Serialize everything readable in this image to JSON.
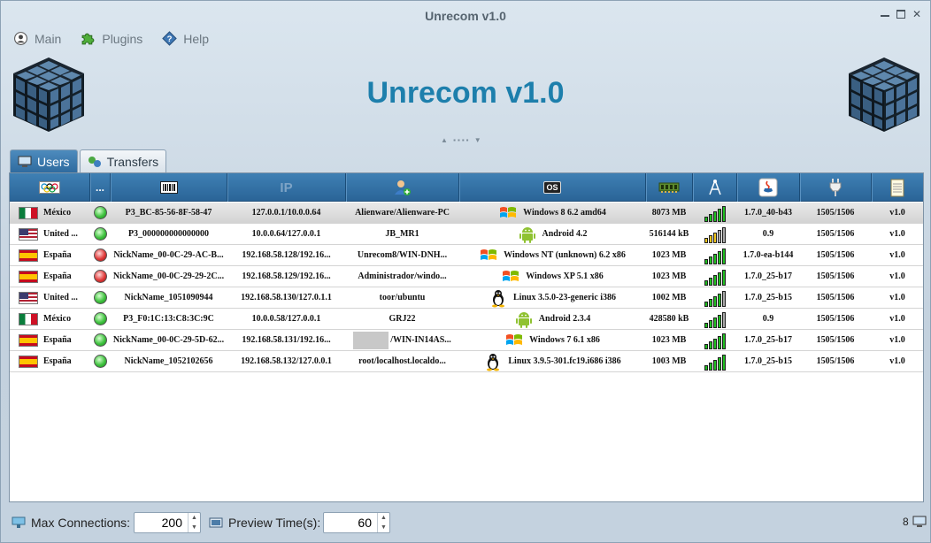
{
  "window": {
    "title": "Unrecom v1.0"
  },
  "menu": [
    {
      "label": "Main",
      "icon": "user-icon"
    },
    {
      "label": "Plugins",
      "icon": "puzzle-icon"
    },
    {
      "label": "Help",
      "icon": "help-icon"
    }
  ],
  "header": {
    "title": "Unrecom v1.0"
  },
  "tabs": [
    {
      "label": "Users",
      "active": true
    },
    {
      "label": "Transfers",
      "active": false
    }
  ],
  "table": {
    "columns": [
      {
        "name": "country",
        "icon": "flag-column-icon"
      },
      {
        "name": "status",
        "label": "..."
      },
      {
        "name": "id",
        "icon": "barcode-icon"
      },
      {
        "name": "ip",
        "label": "IP"
      },
      {
        "name": "user",
        "icon": "add-user-icon"
      },
      {
        "name": "os",
        "label": "OS"
      },
      {
        "name": "ram",
        "icon": "memory-icon"
      },
      {
        "name": "ping",
        "icon": "antenna-icon"
      },
      {
        "name": "java",
        "icon": "java-icon"
      },
      {
        "name": "transfer",
        "icon": "plug-icon"
      },
      {
        "name": "version",
        "icon": "notepad-icon"
      }
    ],
    "rows": [
      {
        "flag": "mx",
        "country": "México",
        "status": "green",
        "id": "P3_BC-85-56-8F-58-47",
        "ip": "127.0.0.1/10.0.0.64",
        "user": "Alienware/Alienware-PC",
        "os_icon": "windows",
        "os": "Windows 8 6.2 amd64",
        "ram": "8073 MB",
        "signal": 5,
        "signal_color": "g",
        "java": "1.7.0_40-b43",
        "transfer": "1505/1506",
        "version": "v1.0",
        "selected": true
      },
      {
        "flag": "us",
        "country": "United ...",
        "status": "green",
        "id": "P3_000000000000000",
        "ip": "10.0.0.64/127.0.0.1",
        "user": "JB_MR1",
        "os_icon": "android",
        "os": "Android  4.2",
        "ram": "516144 kB",
        "signal": 3,
        "signal_color": "y",
        "java": "0.9",
        "transfer": "1505/1506",
        "version": "v1.0"
      },
      {
        "flag": "es",
        "country": "España",
        "status": "red",
        "id": "NickName_00-0C-29-AC-B...",
        "ip": "192.168.58.128/192.16...",
        "user": "Unrecom8/WIN-DNH...",
        "os_icon": "windows",
        "os": "Windows NT (unknown) 6.2 x86",
        "ram": "1023 MB",
        "signal": 5,
        "signal_color": "g",
        "java": "1.7.0-ea-b144",
        "transfer": "1505/1506",
        "version": "v1.0"
      },
      {
        "flag": "es",
        "country": "España",
        "status": "red",
        "id": "NickName_00-0C-29-29-2C...",
        "ip": "192.168.58.129/192.16...",
        "user": "Administrador/windo...",
        "os_icon": "windows",
        "os": "Windows XP 5.1 x86",
        "ram": "1023 MB",
        "signal": 5,
        "signal_color": "g",
        "java": "1.7.0_25-b17",
        "transfer": "1505/1506",
        "version": "v1.0"
      },
      {
        "flag": "us",
        "country": "United ...",
        "status": "green",
        "id": "NickName_1051090944",
        "ip": "192.168.58.130/127.0.1.1",
        "user": "toor/ubuntu",
        "os_icon": "linux",
        "os": "Linux 3.5.0-23-generic i386",
        "ram": "1002 MB",
        "signal": 4,
        "signal_color": "g",
        "java": "1.7.0_25-b15",
        "transfer": "1505/1506",
        "version": "v1.0"
      },
      {
        "flag": "mx",
        "country": "México",
        "status": "green",
        "id": "P3_F0:1C:13:C8:3C:9C",
        "ip": "10.0.0.58/127.0.0.1",
        "user": "GRJ22",
        "os_icon": "android",
        "os": "Android  2.3.4",
        "ram": "428580 kB",
        "signal": 4,
        "signal_color": "g",
        "java": "0.9",
        "transfer": "1505/1506",
        "version": "v1.0"
      },
      {
        "flag": "es",
        "country": "España",
        "status": "green",
        "id": "NickName_00-0C-29-5D-62...",
        "ip": "192.168.58.131/192.16...",
        "user": "/WIN-IN14AS...",
        "user_blank": true,
        "os_icon": "windows",
        "os": "Windows 7 6.1 x86",
        "ram": "1023 MB",
        "signal": 5,
        "signal_color": "g",
        "java": "1.7.0_25-b17",
        "transfer": "1505/1506",
        "version": "v1.0"
      },
      {
        "flag": "es",
        "country": "España",
        "status": "green",
        "id": "NickName_1052102656",
        "ip": "192.168.58.132/127.0.0.1",
        "user": "root/localhost.localdo...",
        "os_icon": "linux",
        "os": "Linux 3.9.5-301.fc19.i686 i386",
        "ram": "1003 MB",
        "signal": 5,
        "signal_color": "g",
        "java": "1.7.0_25-b15",
        "transfer": "1505/1506",
        "version": "v1.0"
      }
    ]
  },
  "footer": {
    "max_connections_label": "Max Connections:",
    "max_connections_value": "200",
    "preview_time_label": "Preview Time(s):",
    "preview_time_value": "60",
    "count": "8"
  }
}
